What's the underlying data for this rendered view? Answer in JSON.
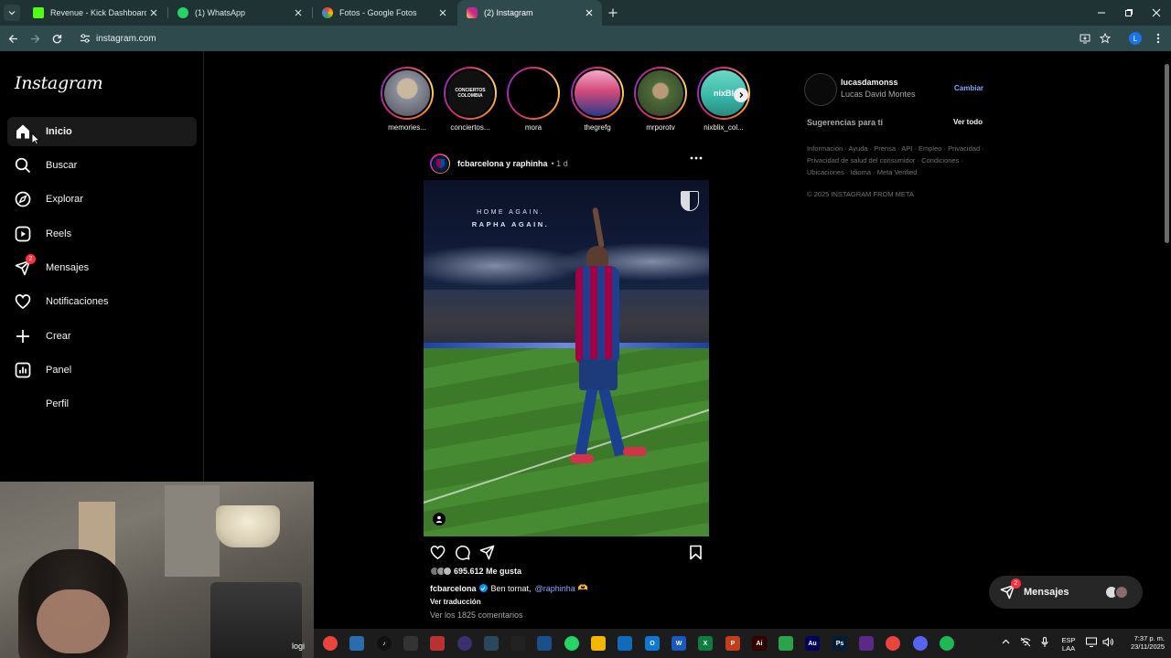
{
  "browser": {
    "tabs": [
      {
        "title": "Revenue - Kick Dashboard",
        "favicon_color": "#53fc18",
        "active": false
      },
      {
        "title": "(1) WhatsApp",
        "favicon_color": "#25d366",
        "active": false
      },
      {
        "title": "Fotos - Google Fotos",
        "favicon_color": "#fbbc04",
        "active": false
      },
      {
        "title": "(2) Instagram",
        "favicon_color": "#e1306c",
        "active": true
      }
    ],
    "url": "instagram.com",
    "profile_initial": "L",
    "theme_color": "#2f4a4d"
  },
  "instagram": {
    "logo": "Instagram",
    "nav": [
      {
        "label": "Inicio",
        "icon": "home-icon",
        "active": true
      },
      {
        "label": "Buscar",
        "icon": "search-icon"
      },
      {
        "label": "Explorar",
        "icon": "compass-icon"
      },
      {
        "label": "Reels",
        "icon": "reels-icon"
      },
      {
        "label": "Mensajes",
        "icon": "messenger-icon",
        "badge": "2"
      },
      {
        "label": "Notificaciones",
        "icon": "heart-icon"
      },
      {
        "label": "Crear",
        "icon": "plus-icon"
      },
      {
        "label": "Panel",
        "icon": "chart-icon"
      },
      {
        "label": "Perfil",
        "icon": "profile-icon"
      }
    ],
    "stories": [
      {
        "name": "memories...",
        "color": "#8a8f9a"
      },
      {
        "name": "conciertos...",
        "color": "#111111",
        "text": "CONCIERTOS COLOMBIA"
      },
      {
        "name": "mora",
        "color": "#000000"
      },
      {
        "name": "thegrefg",
        "color": "#d44a7a"
      },
      {
        "name": "mrporotv",
        "color": "#4e6a3a"
      },
      {
        "name": "nixblix_col...",
        "color": "#35b6a8",
        "text": "nixBl"
      }
    ],
    "post": {
      "user": "fcbarcelona y raphinha",
      "time": "• 1 d",
      "overlay_line1": "HOME AGAIN.",
      "overlay_line2": "RAPHA AGAIN.",
      "likes": "695.612 Me gusta",
      "caption_user": "fcbarcelona",
      "caption_text": "Ben tornat,",
      "caption_mention": "@raphinha",
      "caption_emoji": "🫶",
      "translation": "Ver traducción",
      "comments": "Ver los 1825 comentarios"
    },
    "account": {
      "username": "lucasdamonss",
      "full_name": "Lucas David Montes",
      "switch": "Cambiar"
    },
    "suggestions": {
      "title": "Sugerencias para ti",
      "see_all": "Ver todo"
    },
    "footer": {
      "links": "Información · Ayuda · Prensa · API · Empleo · Privacidad · Privacidad de salud del consumidor · Condiciones · Ubicaciones · Idioma · Meta Verified",
      "copyright": "© 2025 INSTAGRAM FROM META"
    },
    "messages_float": {
      "label": "Mensajes",
      "badge": "2"
    }
  },
  "webcam": {
    "label": "logi"
  },
  "taskbar": {
    "apps": [
      {
        "name": "chrome",
        "color": "#e8453c",
        "text": ""
      },
      {
        "name": "store",
        "color": "#2b6cb0",
        "text": ""
      },
      {
        "name": "tiktok",
        "color": "#111111",
        "text": "♪"
      },
      {
        "name": "speedtest",
        "color": "#333333",
        "text": ""
      },
      {
        "name": "app",
        "color": "#b83232",
        "text": ""
      },
      {
        "name": "obs",
        "color": "#3b2f6e",
        "text": ""
      },
      {
        "name": "steam",
        "color": "#2a475e",
        "text": ""
      },
      {
        "name": "capcut",
        "color": "#222222",
        "text": ""
      },
      {
        "name": "app",
        "color": "#1a4f8a",
        "text": ""
      },
      {
        "name": "whatsapp",
        "color": "#25d366",
        "text": ""
      },
      {
        "name": "explorer",
        "color": "#f2b705",
        "text": ""
      },
      {
        "name": "app",
        "color": "#0f6cbd",
        "text": ""
      },
      {
        "name": "outlook",
        "color": "#0f78d4",
        "text": "O"
      },
      {
        "name": "word",
        "color": "#185abd",
        "text": "W"
      },
      {
        "name": "excel",
        "color": "#107c41",
        "text": "X"
      },
      {
        "name": "powerpoint",
        "color": "#c43e1c",
        "text": "P"
      },
      {
        "name": "illustrator",
        "color": "#330000",
        "text": "Ai"
      },
      {
        "name": "app",
        "color": "#2aa34a",
        "text": ""
      },
      {
        "name": "audition",
        "color": "#00005b",
        "text": "Au"
      },
      {
        "name": "photoshop",
        "color": "#001e36",
        "text": "Ps"
      },
      {
        "name": "app",
        "color": "#5b2a86",
        "text": ""
      },
      {
        "name": "chrome",
        "color": "#e8453c",
        "text": ""
      },
      {
        "name": "discord",
        "color": "#5865f2",
        "text": ""
      },
      {
        "name": "spotify",
        "color": "#1db954",
        "text": ""
      }
    ],
    "lang": "ESP",
    "lang2": "LAA",
    "time": "7:37 p. m.",
    "date": "23/11/2025"
  }
}
